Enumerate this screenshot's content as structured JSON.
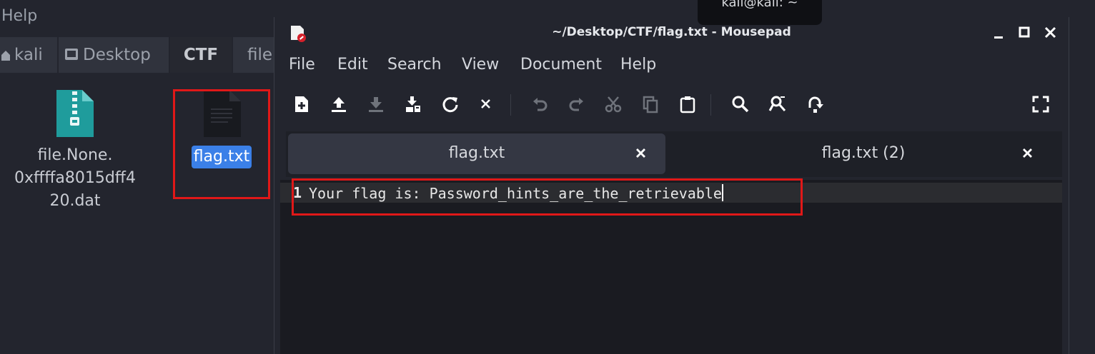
{
  "file_manager": {
    "menu_help": "Help",
    "breadcrumbs": [
      {
        "label": "kali",
        "icon": "home-icon"
      },
      {
        "label": "Desktop",
        "icon": "desktop-icon"
      },
      {
        "label": "CTF",
        "icon": ""
      },
      {
        "label": "file",
        "icon": ""
      }
    ],
    "files": [
      {
        "name": "file.None.0xffffa8015dff420.dat",
        "line1": "file.None.",
        "line2": "0xffffa8015dff4",
        "line3": "20.dat",
        "icon": "zip-archive-icon"
      },
      {
        "name": "flag.txt",
        "icon": "text-file-icon",
        "selected": true
      }
    ]
  },
  "tooltip": {
    "text": "kali@kali: ~"
  },
  "editor_window": {
    "title": "~/Desktop/CTF/flag.txt - Mousepad",
    "menu": [
      "File",
      "Edit",
      "Search",
      "View",
      "Document",
      "Help"
    ],
    "tabs": [
      {
        "label": "flag.txt",
        "active": true
      },
      {
        "label": "flag.txt (2)",
        "active": false
      }
    ],
    "lines": [
      {
        "number": "1",
        "text": "Your flag is: Password_hints_are_the_retrievable"
      }
    ]
  },
  "colors": {
    "highlight_red": "#e01818",
    "selection_blue": "#3b80e8",
    "background": "#23252e"
  }
}
